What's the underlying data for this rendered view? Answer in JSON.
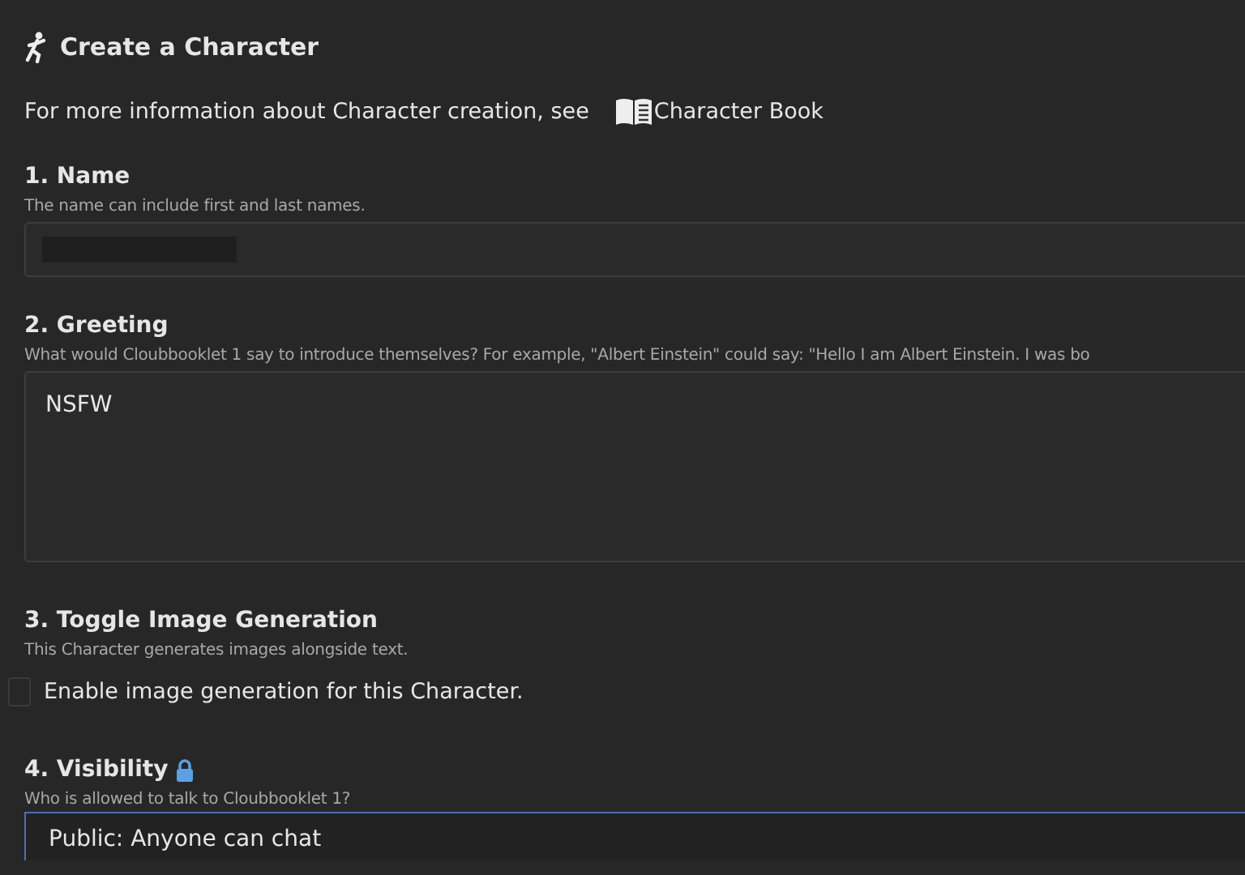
{
  "header": {
    "title": "Create a Character"
  },
  "info": {
    "text": "For more information about Character creation, see",
    "link": "Character Book"
  },
  "sections": [
    {
      "kind": "text",
      "heading": "1. Name",
      "hint": "The name can include first and last names.",
      "value_redacted": true
    },
    {
      "kind": "textarea",
      "heading": "2. Greeting",
      "hint": "What would Cloubbooklet 1 say to introduce themselves? For example, \"Albert Einstein\" could say: \"Hello I am Albert Einstein. I was bo",
      "value": "NSFW"
    },
    {
      "kind": "checkbox",
      "heading": "3. Toggle Image Generation",
      "hint": "This Character generates images alongside text.",
      "label": "Enable image generation for this Character.",
      "checked": false
    },
    {
      "kind": "select",
      "heading": "4. Visibility",
      "locked": true,
      "hint": "Who is allowed to talk to Cloubbooklet 1?",
      "value": "Public: Anyone can chat",
      "focused": true
    }
  ]
}
